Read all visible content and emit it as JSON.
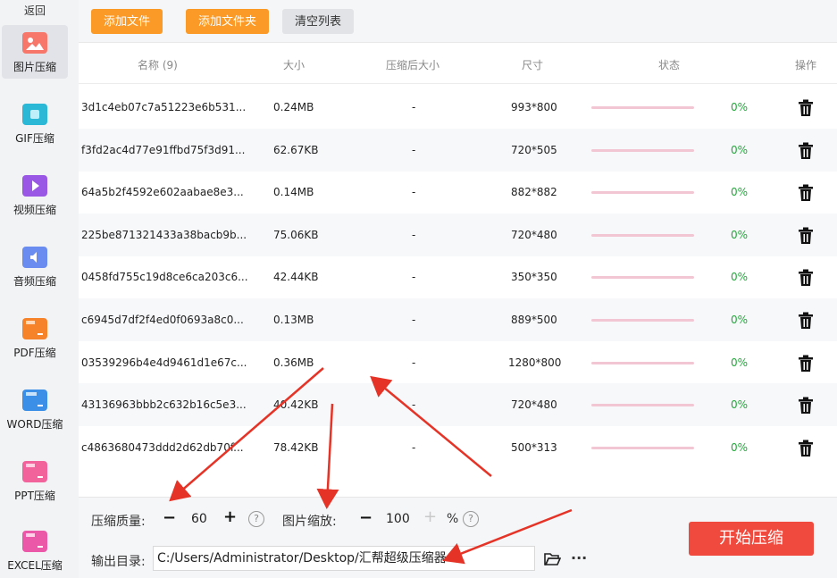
{
  "sidebar": {
    "back_label": "返回",
    "items": [
      {
        "label": "图片压缩",
        "icon": "image-icon",
        "color": "#f7786b",
        "active": true
      },
      {
        "label": "GIF压缩",
        "icon": "gif-icon",
        "color": "#2bb7d6"
      },
      {
        "label": "视频压缩",
        "icon": "video-icon",
        "color": "#9a57e6"
      },
      {
        "label": "音频压缩",
        "icon": "audio-icon",
        "color": "#6a8cf0"
      },
      {
        "label": "PDF压缩",
        "icon": "pdf-icon",
        "color": "#f6822a"
      },
      {
        "label": "WORD压缩",
        "icon": "word-icon",
        "color": "#3c8fe6"
      },
      {
        "label": "PPT压缩",
        "icon": "ppt-icon",
        "color": "#f2639c"
      },
      {
        "label": "EXCEL压缩",
        "icon": "excel-icon",
        "color": "#ec58a8"
      }
    ]
  },
  "toolbar": {
    "add_file_label": "添加文件",
    "add_folder_label": "添加文件夹",
    "clear_label": "清空列表"
  },
  "table": {
    "headers": {
      "name": "名称 (9)",
      "size": "大小",
      "compressed_size": "压缩后大小",
      "dimensions": "尺寸",
      "status": "状态",
      "action": "操作"
    },
    "rows": [
      {
        "name": "3d1c4eb07c7a51223e6b531...",
        "size": "0.24MB",
        "compressed": "-",
        "dims": "993*800",
        "pct": "0%"
      },
      {
        "name": "f3fd2ac4d77e91ffbd75f3d91...",
        "size": "62.67KB",
        "compressed": "-",
        "dims": "720*505",
        "pct": "0%"
      },
      {
        "name": "64a5b2f4592e602aabae8e3...",
        "size": "0.14MB",
        "compressed": "-",
        "dims": "882*882",
        "pct": "0%"
      },
      {
        "name": "225be871321433a38bacb9b...",
        "size": "75.06KB",
        "compressed": "-",
        "dims": "720*480",
        "pct": "0%"
      },
      {
        "name": "0458fd755c19d8ce6ca203c6...",
        "size": "42.44KB",
        "compressed": "-",
        "dims": "350*350",
        "pct": "0%"
      },
      {
        "name": "c6945d7df2f4ed0f0693a8c0...",
        "size": "0.13MB",
        "compressed": "-",
        "dims": "889*500",
        "pct": "0%"
      },
      {
        "name": "03539296b4e4d9461d1e67c...",
        "size": "0.36MB",
        "compressed": "-",
        "dims": "1280*800",
        "pct": "0%"
      },
      {
        "name": "43136963bbb2c632b16c5e3...",
        "size": "40.42KB",
        "compressed": "-",
        "dims": "720*480",
        "pct": "0%"
      },
      {
        "name": "c4863680473ddd2d62db70f...",
        "size": "78.42KB",
        "compressed": "-",
        "dims": "500*313",
        "pct": "0%"
      }
    ]
  },
  "settings": {
    "quality_label": "压缩质量:",
    "quality_value": "60",
    "minus": "−",
    "plus": "+",
    "help": "?",
    "scale_label": "图片缩放:",
    "scale_value": "100",
    "scale_unit": "%",
    "output_label": "输出目录:",
    "output_path": "C:/Users/Administrator/Desktop/汇帮超级压缩器",
    "more": "···",
    "start_label": "开始压缩"
  },
  "colors": {
    "accent_orange": "#fb9a26",
    "start_red": "#f04a3e",
    "status_green": "#22a83a",
    "progress_pink": "#f3c6d4",
    "annotation_arrow": "#e53427"
  }
}
